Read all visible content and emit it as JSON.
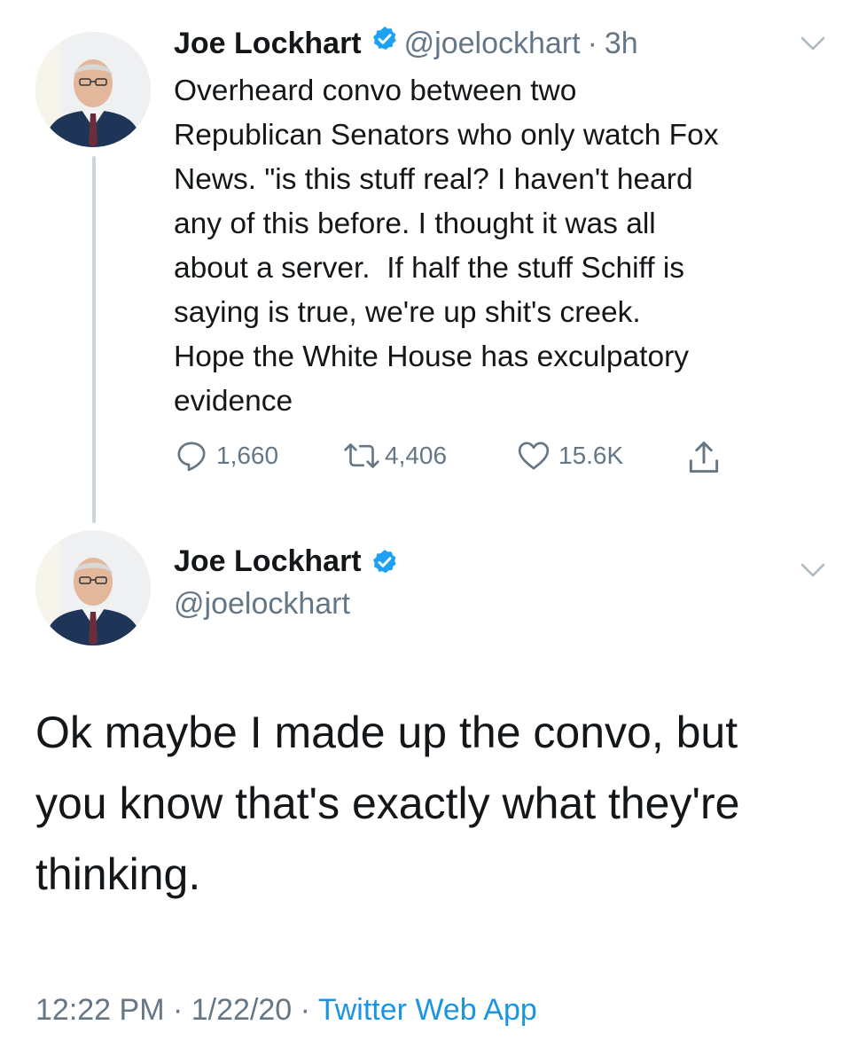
{
  "colors": {
    "accent": "#1da1f2",
    "secondary_text": "#657786",
    "link": "#1b95e0"
  },
  "reply_tweet": {
    "author_name": "Joe Lockhart",
    "handle": "@joelockhart",
    "separator": "·",
    "time": "3h",
    "text": "Overheard convo between two\nRepublican Senators who only watch Fox\nNews. \"is this stuff real? I haven't heard\nany of this before. I thought it was all\nabout a server.  If half the stuff Schiff is\nsaying is true, we're up shit's creek.\nHope the White House has exculpatory\nevidence",
    "replies": "1,660",
    "retweets": "4,406",
    "likes": "15.6K",
    "icons": [
      "reply-icon",
      "retweet-icon",
      "like-icon",
      "share-icon",
      "verified-icon",
      "chevron-down-icon"
    ]
  },
  "main_tweet": {
    "author_name": "Joe Lockhart",
    "handle": "@joelockhart",
    "text": "Ok maybe I made up the convo, but\nyou know that's exactly what they're\nthinking.",
    "time": "12:22 PM",
    "date": "1/22/20",
    "separator": "·",
    "source": "Twitter Web App"
  }
}
